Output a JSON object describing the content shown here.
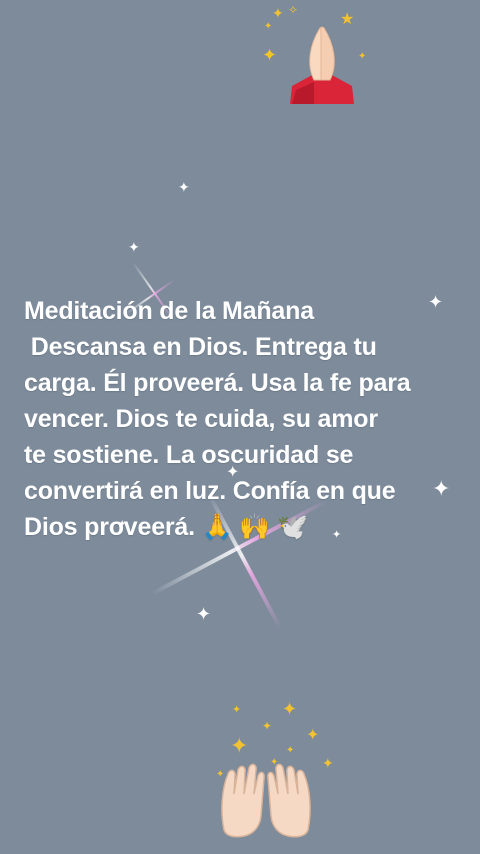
{
  "post": {
    "message": "Meditación de la Mañana\n Descansa en Dios. Entrega tu\ncarga. Él proveerá. Usa la fe para\nvencer. Dios te cuida, su amor\nte sostiene. La oscuridad se\nconvertirá en luz. Confía en que\nDios proveerá. 🙏 🙌 🕊️"
  },
  "decorations": {
    "top_icon": "praying-hands-icon",
    "bottom_icon": "open-hands-icon",
    "sparkle_icon": "sparkle-star-icon"
  },
  "colors": {
    "background": "#7d8b9b",
    "text": "#ffffff",
    "gold_sparkle": "#f2c230",
    "flare_pink": "#f0a8e6"
  }
}
